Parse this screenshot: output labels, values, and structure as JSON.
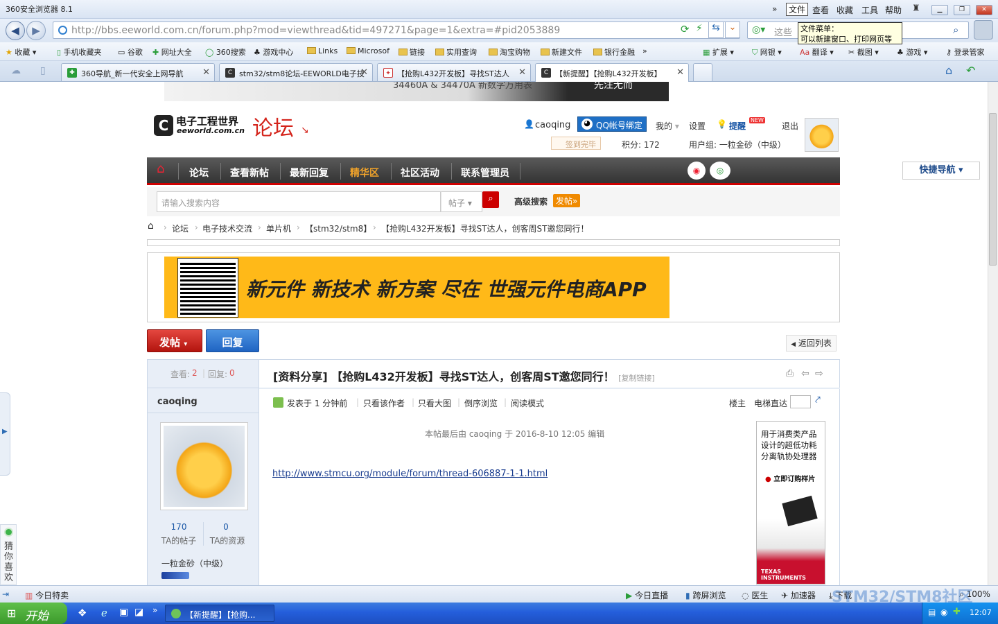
{
  "browser": {
    "title": "360安全浏览器 8.1",
    "menu": [
      "»",
      "文件",
      "查看",
      "收藏",
      "工具",
      "帮助"
    ],
    "tooltip": {
      "line1": "文件菜单：",
      "line2": "可以新建窗口、打印网页等"
    },
    "url": "http://bbs.eeworld.com.cn/forum.php?mod=viewthread&tid=497271&page=1&extra=#pid2053889",
    "search_placeholder": "这些",
    "favorites": [
      "收藏",
      "手机收藏夹",
      "谷歌",
      "网址大全",
      "360搜索",
      "游戏中心",
      "Links",
      "Microsof",
      "链接",
      "实用查询",
      "淘宝购物",
      "新建文件",
      "银行金融",
      "»"
    ],
    "extensions": [
      "扩展",
      "网银",
      "翻译",
      "截图",
      "游戏",
      "登录管家"
    ],
    "tabs": [
      {
        "label": "360导航_新一代安全上网导航",
        "active": false
      },
      {
        "label": "stm32/stm8论坛-EEWORLD电子技",
        "active": false
      },
      {
        "label": "【抢购L432开发板】寻找ST达人",
        "active": false
      },
      {
        "label": "【新提醒】【抢购L432开发板】",
        "active": true
      }
    ]
  },
  "site": {
    "logo_cn": "电子工程世界",
    "logo_en": "eeworld.com.cn",
    "logo_forum": "论坛",
    "user": {
      "name": "caoqing",
      "qq_bind": "QQ帐号绑定",
      "mine": "我的",
      "settings": "设置",
      "remind": "提醒",
      "new_badge": "NEW",
      "logout": "退出",
      "checkin": "签到完毕",
      "points": "积分: 172",
      "group": "用户组: 一粒金砂（中级）"
    },
    "nav": [
      "论坛",
      "查看新帖",
      "最新回复",
      "精华区",
      "社区活动",
      "联系管理员"
    ],
    "quick_nav": "快捷导航",
    "search": {
      "placeholder": "请输入搜索内容",
      "type": "帖子",
      "advanced": "高级搜索",
      "post": "发帖"
    },
    "breadcrumb": [
      "论坛",
      "电子技术交流",
      "单片机",
      "【stm32/stm8】",
      "【抢购L432开发板】寻找ST达人，创客周ST邀您同行！"
    ],
    "banner_text": "新元件 新技术 新方案 尽在 世强元件电商APP",
    "top_ad_text": "34460A & 34470A 新数字万用表",
    "top_ad_right": "先注无而"
  },
  "thread": {
    "post_btn": "发帖",
    "reply_btn": "回复",
    "back_list": "返回列表",
    "views_label": "查看:",
    "views": "2",
    "replies_label": "回复:",
    "replies": "0",
    "title": "[资料分享] 【抢购L432开发板】寻找ST达人，创客周ST邀您同行！",
    "copy_link": "[复制链接]",
    "posted": "发表于 1 分钟前",
    "actions": [
      "只看该作者",
      "只看大图",
      "倒序浏览",
      "阅读模式"
    ],
    "floor": "楼主",
    "jump": "电梯直达",
    "edit_note": "本帖最后由 caoqing 于 2016-8-10 12:05 编辑",
    "link": "http://www.stmcu.org/module/forum/thread-606887-1-1.html",
    "author": {
      "name": "caoqing",
      "posts": "170",
      "posts_label": "TA的帖子",
      "resources": "0",
      "resources_label": "TA的资源",
      "level": "一粒金砂（中级）"
    },
    "side_ad": {
      "text": "用于消费类产品设计的超低功耗分离轨协处理器",
      "cta": "立即订购样片",
      "brand": "TEXAS INSTRUMENTS"
    }
  },
  "guess": "猜你喜欢",
  "status": {
    "items": [
      "今日特卖",
      "今日直播",
      "跨屏浏览",
      "医生",
      "加速器",
      "下载",
      "100%"
    ]
  },
  "taskbar": {
    "start": "开始",
    "task": "【新提醒】【抢购...",
    "time": "12:07",
    "watermark": "STM32/STM8社区"
  }
}
